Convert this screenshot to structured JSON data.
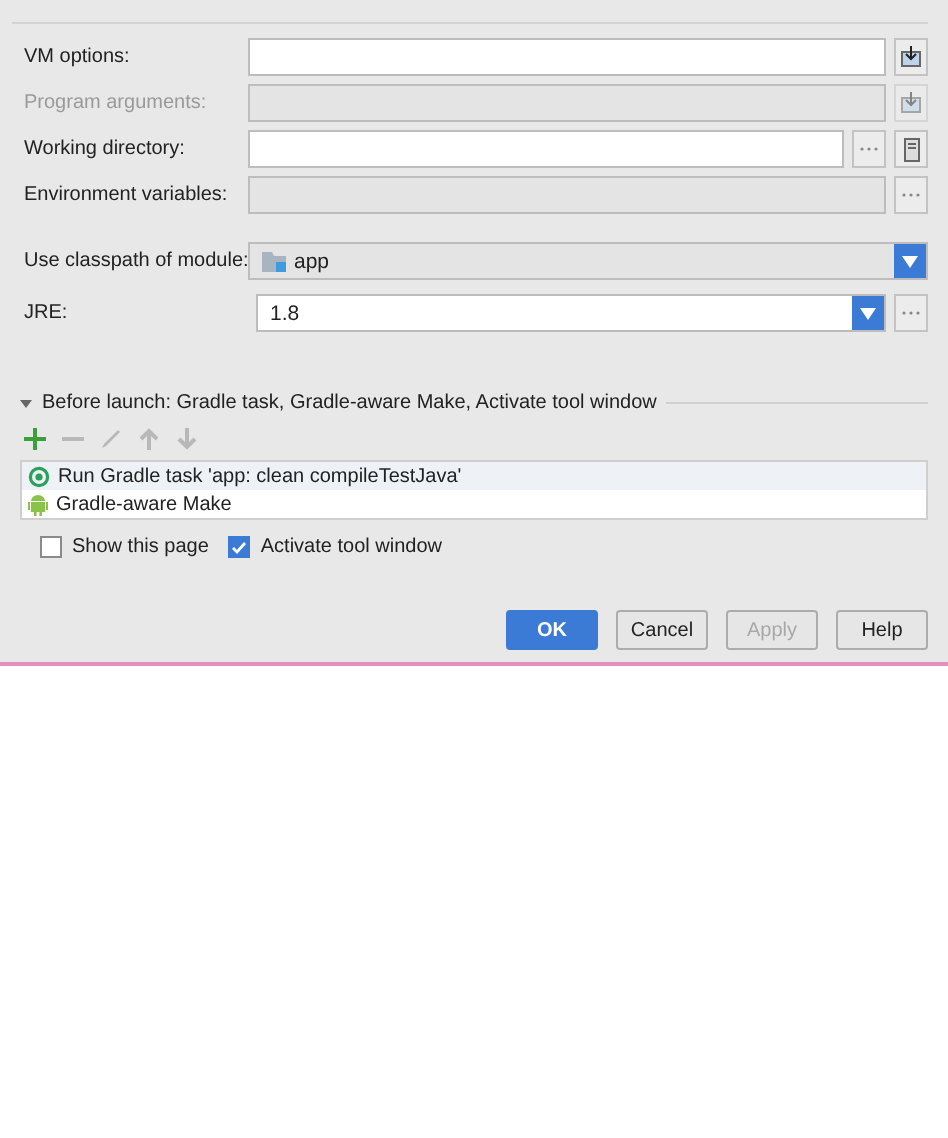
{
  "fields": [
    {
      "kind": "text",
      "label": "VM options:",
      "disabled": false,
      "buttons": [
        {
          "kind": "expand"
        }
      ]
    },
    {
      "kind": "text",
      "label": "Program arguments:",
      "disabled": true,
      "buttons": [
        {
          "kind": "expand"
        }
      ]
    },
    {
      "kind": "text",
      "label": "Working directory:",
      "disabled": false,
      "buttons": [
        {
          "kind": "browse"
        },
        {
          "kind": "macro"
        }
      ]
    },
    {
      "kind": "readonly",
      "label": "Environment variables:",
      "disabled": false,
      "buttons": [
        {
          "kind": "browse"
        }
      ]
    },
    {
      "kind": "combo",
      "label": "Use classpath of module:",
      "value": "app",
      "disabled": false
    },
    {
      "kind": "editcombo",
      "label": "JRE:",
      "value": "1.8",
      "disabled": false,
      "buttons": [
        {
          "kind": "browse"
        }
      ]
    }
  ],
  "before_launch": {
    "title": "Before launch: Gradle task, Gradle-aware Make, Activate tool window",
    "toolbar": [
      {
        "kind": "add",
        "disabled": false
      },
      {
        "kind": "remove",
        "disabled": true
      },
      {
        "kind": "edit",
        "disabled": true
      },
      {
        "kind": "up",
        "disabled": true
      },
      {
        "kind": "down",
        "disabled": true
      }
    ],
    "tasks": [
      {
        "kind": "gradle",
        "label": "Run Gradle task 'app: clean compileTestJava'",
        "selected": true
      },
      {
        "kind": "android",
        "label": "Gradle-aware Make",
        "selected": false
      }
    ]
  },
  "options": [
    {
      "label": "Show this page",
      "checked": false
    },
    {
      "label": "Activate tool window",
      "checked": true
    }
  ],
  "buttons": [
    {
      "label": "OK",
      "kind": "default",
      "disabled": false
    },
    {
      "label": "Cancel",
      "kind": "normal",
      "disabled": false
    },
    {
      "label": "Apply",
      "kind": "normal",
      "disabled": true
    },
    {
      "label": "Help",
      "kind": "normal",
      "disabled": false
    }
  ]
}
